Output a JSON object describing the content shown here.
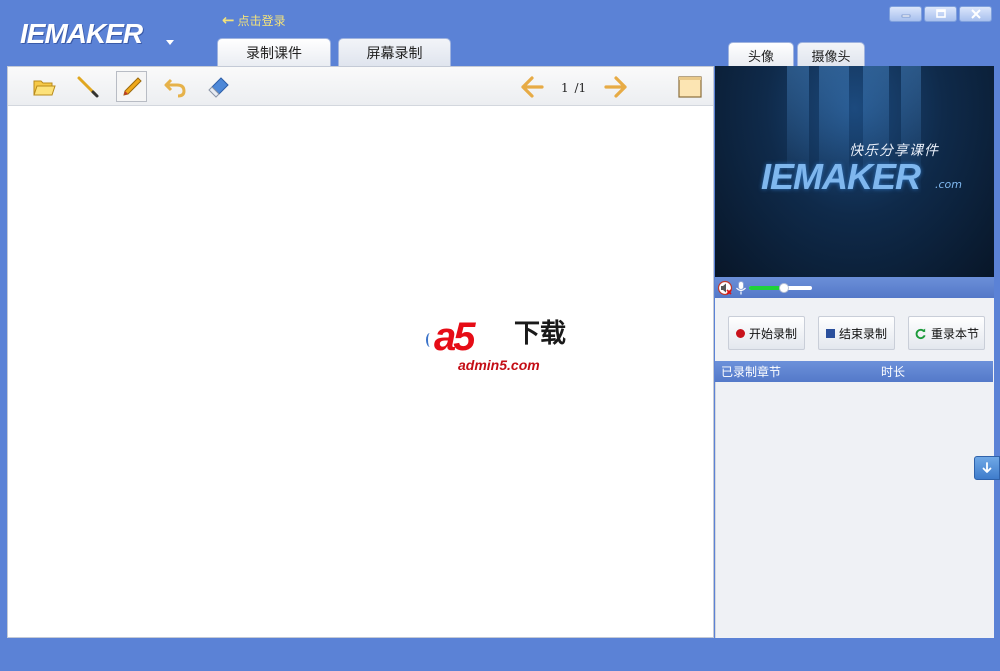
{
  "app": {
    "logo": "IEMAKER",
    "login_link": "点击登录"
  },
  "tabs": {
    "record_course": "录制课件",
    "screen_record": "屏幕录制",
    "avatar": "头像",
    "camera": "摄像头"
  },
  "toolbar": {
    "page_current": "1",
    "page_total": "/1",
    "icons": [
      "folder-open-icon",
      "pen-icon",
      "pencil-icon",
      "undo-icon",
      "eraser-icon",
      "arrow-left-icon",
      "arrow-right-icon",
      "page-view-icon"
    ]
  },
  "watermark": {
    "brand": "a5",
    "brand_cn": "下载",
    "url": "admin5.com"
  },
  "preview": {
    "slogan": "快乐分享课件",
    "logo": "IEMAKER",
    "logo_suffix": ".com"
  },
  "audio": {
    "volume_fraction": 0.55
  },
  "record": {
    "start_label": "开始录制",
    "stop_label": "结束录制",
    "redo_label": "重录本节"
  },
  "chapter_list": {
    "col_name": "已录制章节",
    "col_duration": "时长",
    "rows": []
  },
  "colors": {
    "frame": "#5b82d6",
    "accent_yellow": "#f3e27a",
    "record_red": "#c8121b",
    "stop_blue": "#2a4f9c",
    "volume_green": "#1fd13a"
  }
}
